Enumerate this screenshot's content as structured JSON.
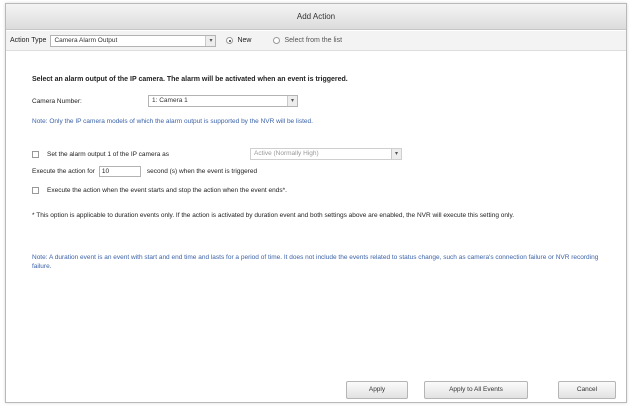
{
  "dialog": {
    "title": "Add Action"
  },
  "type_bar": {
    "label": "Action Type",
    "selected": "Camera Alarm Output",
    "new_label": "New",
    "from_list_label": "Select from the list"
  },
  "main": {
    "heading": "Select an alarm output of the IP camera. The alarm will be activated when an event is triggered.",
    "camera_number_label": "Camera Number:",
    "camera_number_value": "1: Camera 1",
    "note1": "Note: Only the IP camera models of which the alarm output is supported by the NVR will be listed.",
    "set_output_label": "Set the alarm output 1 of the IP camera as",
    "output_mode_value": "Active (Normally High)",
    "execute_prefix": "Execute the action for",
    "execute_seconds": "10",
    "execute_suffix": "second (s) when the event is triggered",
    "duration_option_label": "Execute the action when the event starts and stop the action when the event ends*.",
    "footnote": "* This option is applicable to duration events only. If the action is activated by duration event and both settings above are enabled, the NVR will execute this setting only.",
    "note2": "Note: A duration event is an event with start and end time and lasts for a period of time. It does not include the events related to status change, such as camera's connection failure or NVR recording failure."
  },
  "buttons": {
    "apply": "Apply",
    "apply_all": "Apply to All Events",
    "cancel": "Cancel"
  }
}
